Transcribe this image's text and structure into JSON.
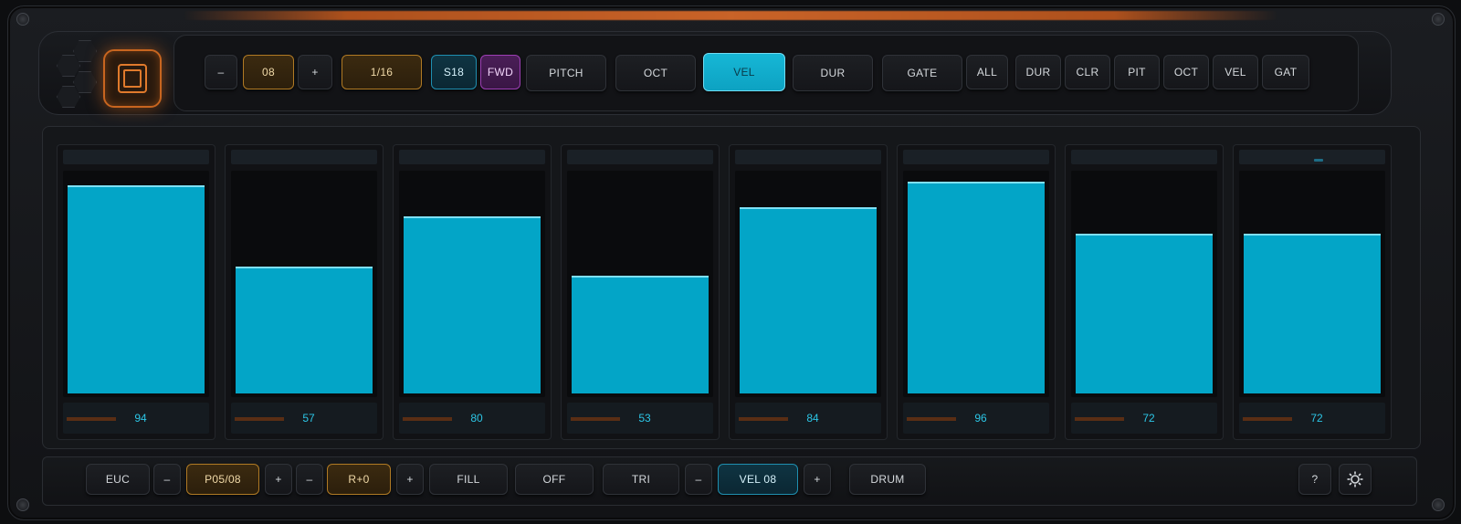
{
  "toolbar": {
    "length_minus": "–",
    "length_value": "08",
    "length_plus": "+",
    "division": "1/16",
    "seed": "S18",
    "direction": "FWD",
    "modes": [
      "PITCH",
      "OCT",
      "VEL",
      "DUR",
      "GATE"
    ],
    "active_mode": "VEL",
    "randomize": [
      "ALL",
      "DUR",
      "CLR",
      "PIT",
      "OCT",
      "VEL",
      "GAT"
    ]
  },
  "steps": [
    {
      "value": "94",
      "level": 94
    },
    {
      "value": "57",
      "level": 57
    },
    {
      "value": "80",
      "level": 80
    },
    {
      "value": "53",
      "level": 53
    },
    {
      "value": "84",
      "level": 84
    },
    {
      "value": "96",
      "level": 96
    },
    {
      "value": "72",
      "level": 72
    },
    {
      "value": "72",
      "level": 72
    }
  ],
  "bottom": {
    "euc": "EUC",
    "minus": "–",
    "pulses": "P05/08",
    "plus": "+",
    "rot_minus": "–",
    "rotation": "R+0",
    "rot_plus": "+",
    "fill": "FILL",
    "off": "OFF",
    "tri": "TRI",
    "vel_minus": "–",
    "vel": "VEL 08",
    "vel_plus": "+",
    "drum": "DRUM",
    "help": "?"
  },
  "colors": {
    "accent": "#03a5c7",
    "orange": "#c8651f",
    "purple": "#9c3fb4"
  },
  "icons": {
    "logo": "square-stack-icon",
    "settings": "gear-icon"
  }
}
